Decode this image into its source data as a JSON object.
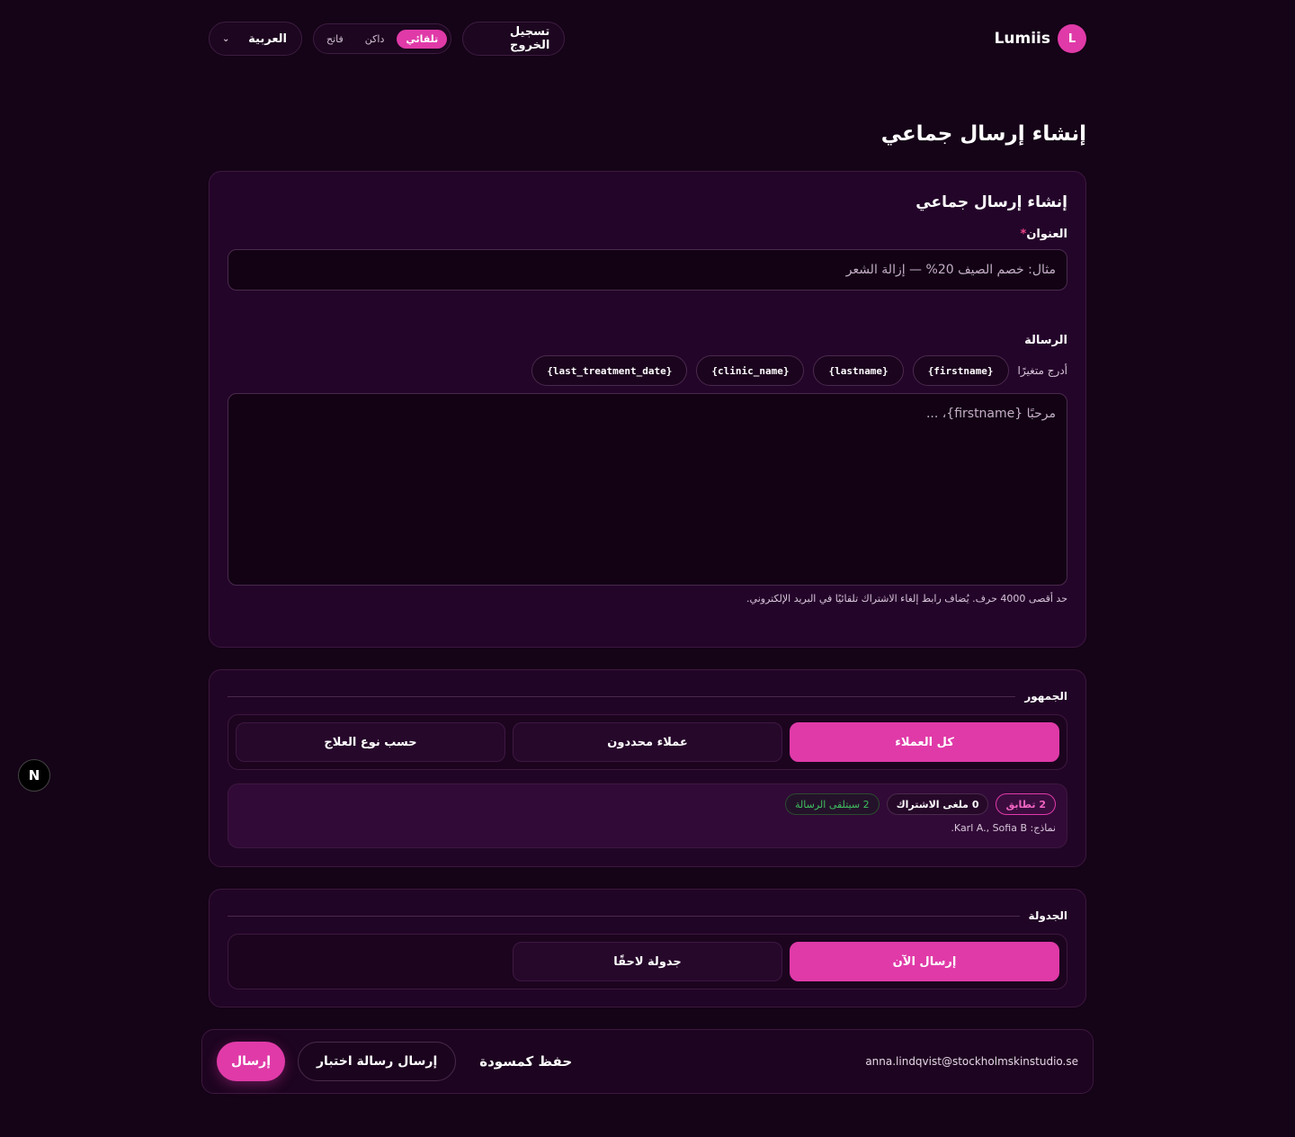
{
  "header": {
    "brand": "Lumiis",
    "avatar_letter": "L",
    "language": "العربية",
    "theme_options": [
      "فاتح",
      "داكن",
      "تلقائي"
    ],
    "theme_active": "تلقائي",
    "logout_label": "تسجيل الخروج"
  },
  "page_title": "إنشاء إرسال جماعي",
  "compose": {
    "card_title": "إنشاء إرسال جماعي",
    "title_label": "العنوان",
    "required_mark": "*",
    "title_placeholder": "مثال: خصم الصيف 20% — إزالة الشعر",
    "title_value": "",
    "message_label": "الرسالة",
    "insert_variable_label": "أدرج متغيرًا",
    "variables": [
      "{firstname}",
      "{lastname}",
      "{clinic_name}",
      "{last_treatment_date}"
    ],
    "message_placeholder": "مرحبًا {firstname}، ...",
    "message_value": "",
    "hint": "حد أقصى 4000 حرف. يُضاف رابط إلغاء الاشتراك تلقائيًا في البريد الإلكتروني."
  },
  "audience": {
    "title": "الجمهور",
    "options": [
      "كل العملاء",
      "عملاء محددون",
      "حسب نوع العلاج"
    ],
    "selected": "كل العملاء",
    "badges": {
      "matches": "2 تطابق",
      "unsubscribed": "0 ملغى الاشتراك",
      "recipients": "2 سيتلقى الرسالة"
    },
    "samples": "نماذج: Karl A., Sofia B."
  },
  "schedule": {
    "title": "الجدولة",
    "options": [
      "إرسال الآن",
      "جدولة لاحقًا"
    ],
    "selected": "إرسال الآن"
  },
  "actions": {
    "email": "anna.lindqvist@stockholmskinstudio.se",
    "save_draft": "حفظ كمسودة",
    "send_test": "إرسال رسالة اختبار",
    "send": "إرسال"
  },
  "dev_badge": "N",
  "colors": {
    "accent": "#e03aa8",
    "background": "#150317",
    "card": "#24052a",
    "success": "#3fbf5f"
  }
}
